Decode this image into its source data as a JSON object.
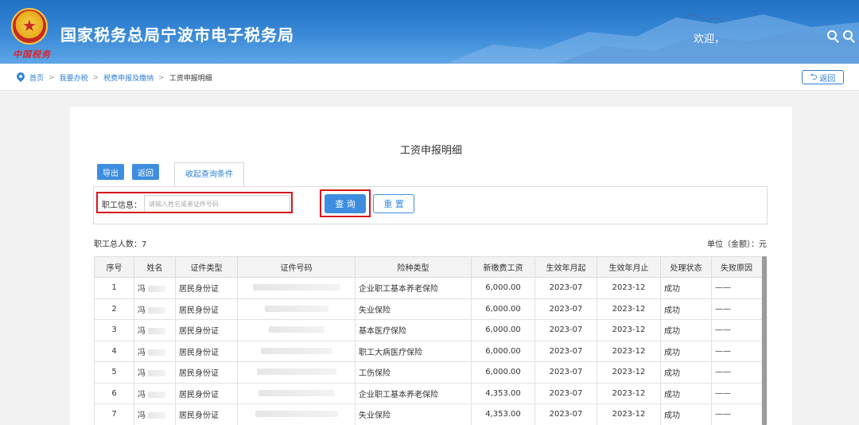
{
  "header": {
    "title": "国家税务总局宁波市电子税务局",
    "signature": "中国税务",
    "welcome": "欢迎，",
    "icons": [
      "zoom-in-icon",
      "zoom-out-icon"
    ],
    "colors": {
      "bar": "#2f80d0",
      "accent": "#3d8ee0",
      "highlight": "#d6161c"
    }
  },
  "breadcrumb": {
    "items": [
      "首页",
      "我要办税",
      "税费申报及缴纳",
      "工资申报明细"
    ],
    "back_label": "返回"
  },
  "panel": {
    "title": "工资申报明细",
    "export_label": "导出",
    "return_label": "返回",
    "tab_label": "收起查询条件",
    "employee_label": "职工信息：",
    "employee_placeholder": "请输入姓名或者证件号码",
    "query_label": "查 询",
    "reset_label": "重 置",
    "total_label": "职工总人数：7",
    "unit_label": "单位（金额）：元"
  },
  "table": {
    "columns": [
      "序号",
      "姓名",
      "证件类型",
      "证件号码",
      "险种类型",
      "新缴费工资",
      "生效年月起",
      "生效年月止",
      "处理状态",
      "失败原因"
    ],
    "rows": [
      {
        "no": "1",
        "name": "冯",
        "id_type": "居民身份证",
        "insurance": "企业职工基本养老保险",
        "wage": "6,000.00",
        "start": "2023-07",
        "end": "2023-12",
        "status": "成功",
        "reason": "——"
      },
      {
        "no": "2",
        "name": "冯",
        "id_type": "居民身份证",
        "insurance": "失业保险",
        "wage": "6,000.00",
        "start": "2023-07",
        "end": "2023-12",
        "status": "成功",
        "reason": "——"
      },
      {
        "no": "3",
        "name": "冯",
        "id_type": "居民身份证",
        "insurance": "基本医疗保险",
        "wage": "6,000.00",
        "start": "2023-07",
        "end": "2023-12",
        "status": "成功",
        "reason": "——"
      },
      {
        "no": "4",
        "name": "冯",
        "id_type": "居民身份证",
        "insurance": "职工大病医疗保险",
        "wage": "6,000.00",
        "start": "2023-07",
        "end": "2023-12",
        "status": "成功",
        "reason": "——"
      },
      {
        "no": "5",
        "name": "冯",
        "id_type": "居民身份证",
        "insurance": "工伤保险",
        "wage": "6,000.00",
        "start": "2023-07",
        "end": "2023-12",
        "status": "成功",
        "reason": "——"
      },
      {
        "no": "6",
        "name": "冯",
        "id_type": "居民身份证",
        "insurance": "企业职工基本养老保险",
        "wage": "4,353.00",
        "start": "2023-07",
        "end": "2023-12",
        "status": "成功",
        "reason": "——"
      },
      {
        "no": "7",
        "name": "冯",
        "id_type": "居民身份证",
        "insurance": "失业保险",
        "wage": "4,353.00",
        "start": "2023-07",
        "end": "2023-12",
        "status": "成功",
        "reason": "——"
      }
    ]
  }
}
